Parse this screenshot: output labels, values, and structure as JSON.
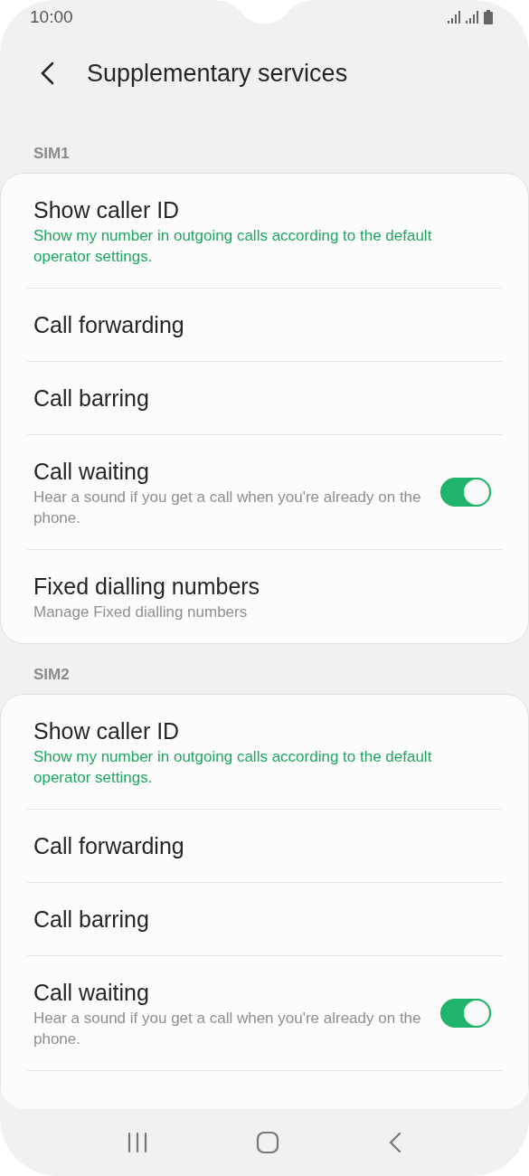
{
  "status_bar": {
    "time": "10:00"
  },
  "header": {
    "title": "Supplementary services"
  },
  "sections": [
    {
      "label": "SIM1",
      "items": [
        {
          "kind": "link",
          "title": "Show caller ID",
          "subtitle": "Show my number in outgoing calls according to the default operator settings.",
          "highlighted": true
        },
        {
          "kind": "link",
          "title": "Call forwarding"
        },
        {
          "kind": "link",
          "title": "Call barring"
        },
        {
          "kind": "toggle",
          "title": "Call waiting",
          "subtitle": "Hear a sound if you get a call when you're already on the phone.",
          "highlighted": false,
          "on": true
        },
        {
          "kind": "link",
          "title": "Fixed dialling numbers",
          "subtitle": "Manage Fixed dialling numbers",
          "highlighted": false
        }
      ]
    },
    {
      "label": "SIM2",
      "items": [
        {
          "kind": "link",
          "title": "Show caller ID",
          "subtitle": "Show my number in outgoing calls according to the default operator settings.",
          "highlighted": true
        },
        {
          "kind": "link",
          "title": "Call forwarding"
        },
        {
          "kind": "link",
          "title": "Call barring"
        },
        {
          "kind": "toggle",
          "title": "Call waiting",
          "subtitle": "Hear a sound if you get a call when you're already on the phone.",
          "highlighted": false,
          "on": true
        }
      ]
    }
  ]
}
